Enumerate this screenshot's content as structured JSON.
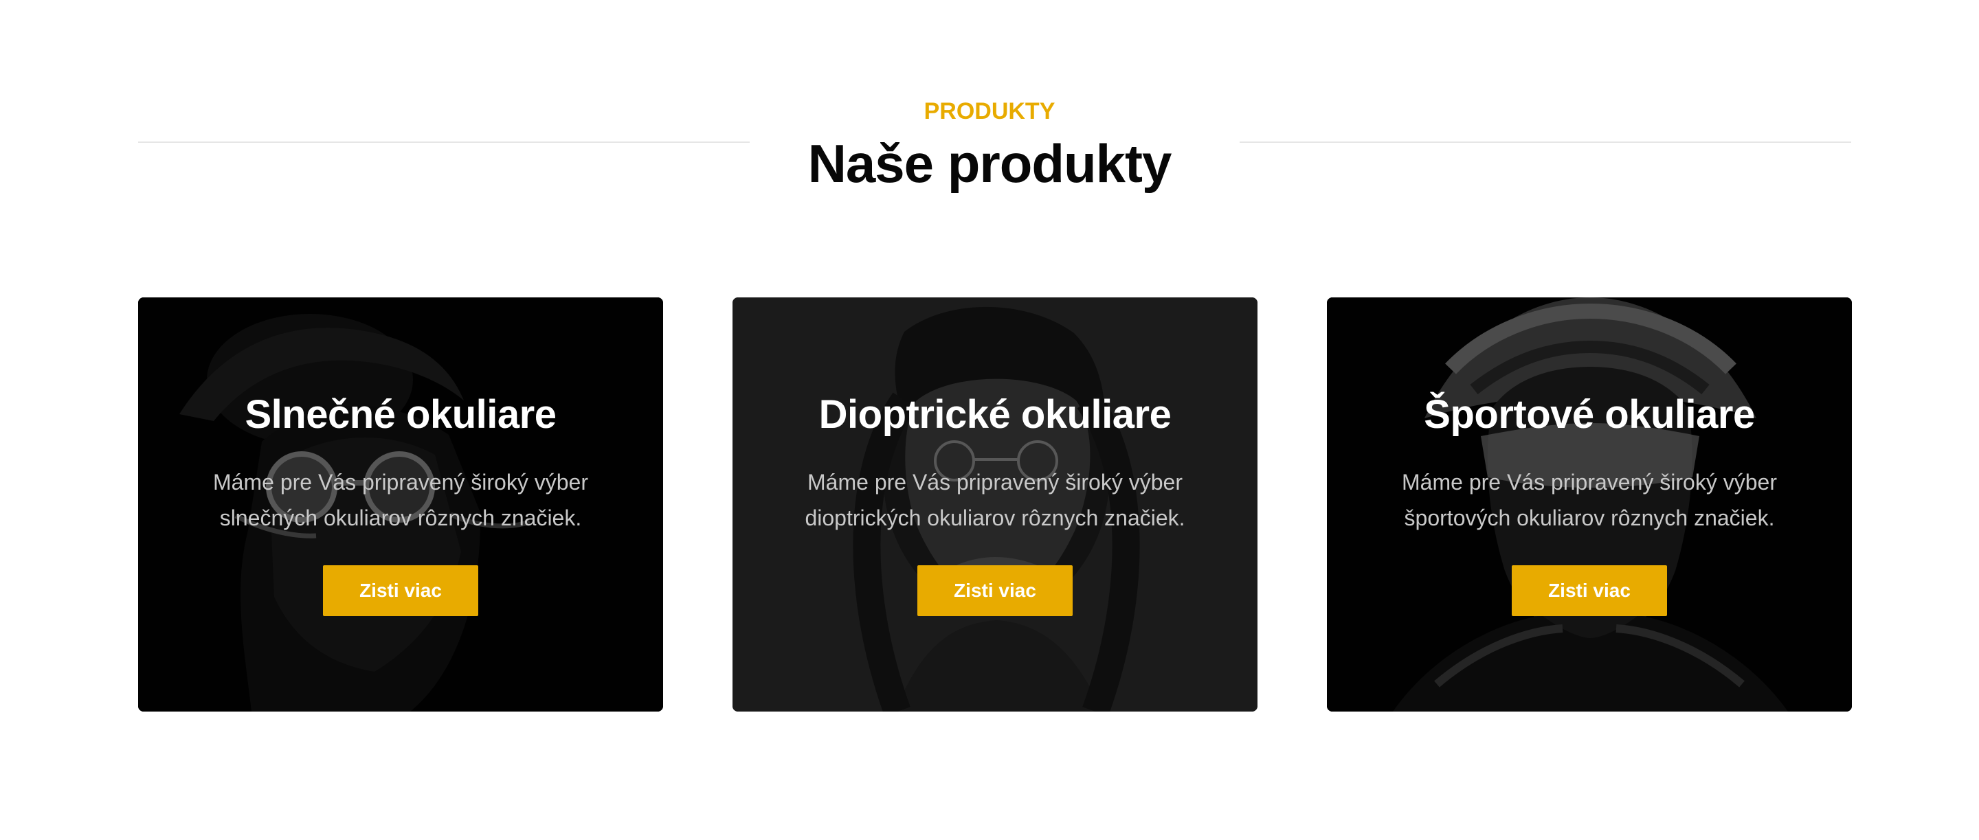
{
  "section": {
    "eyebrow": "PRODUKTY",
    "title": "Naše produkty"
  },
  "colors": {
    "accent": "#e8ab00",
    "title": "#070707",
    "card_bg": "#000000"
  },
  "cards": [
    {
      "title": "Slnečné okuliare",
      "text": "Máme pre Vás pripravený široký výber slnečných okuliarov rôznych značiek.",
      "button": "Zisti viac",
      "image": "man-with-sunglasses"
    },
    {
      "title": "Dioptrické okuliare",
      "text": "Máme pre Vás pripravený široký výber dioptrických okuliarov rôznych značiek.",
      "button": "Zisti viac",
      "image": "woman-with-glasses"
    },
    {
      "title": "Športové okuliare",
      "text": "Máme pre Vás pripravený široký výber športových okuliarov rôznych značiek.",
      "button": "Zisti viac",
      "image": "cyclist-with-sport-glasses"
    }
  ]
}
